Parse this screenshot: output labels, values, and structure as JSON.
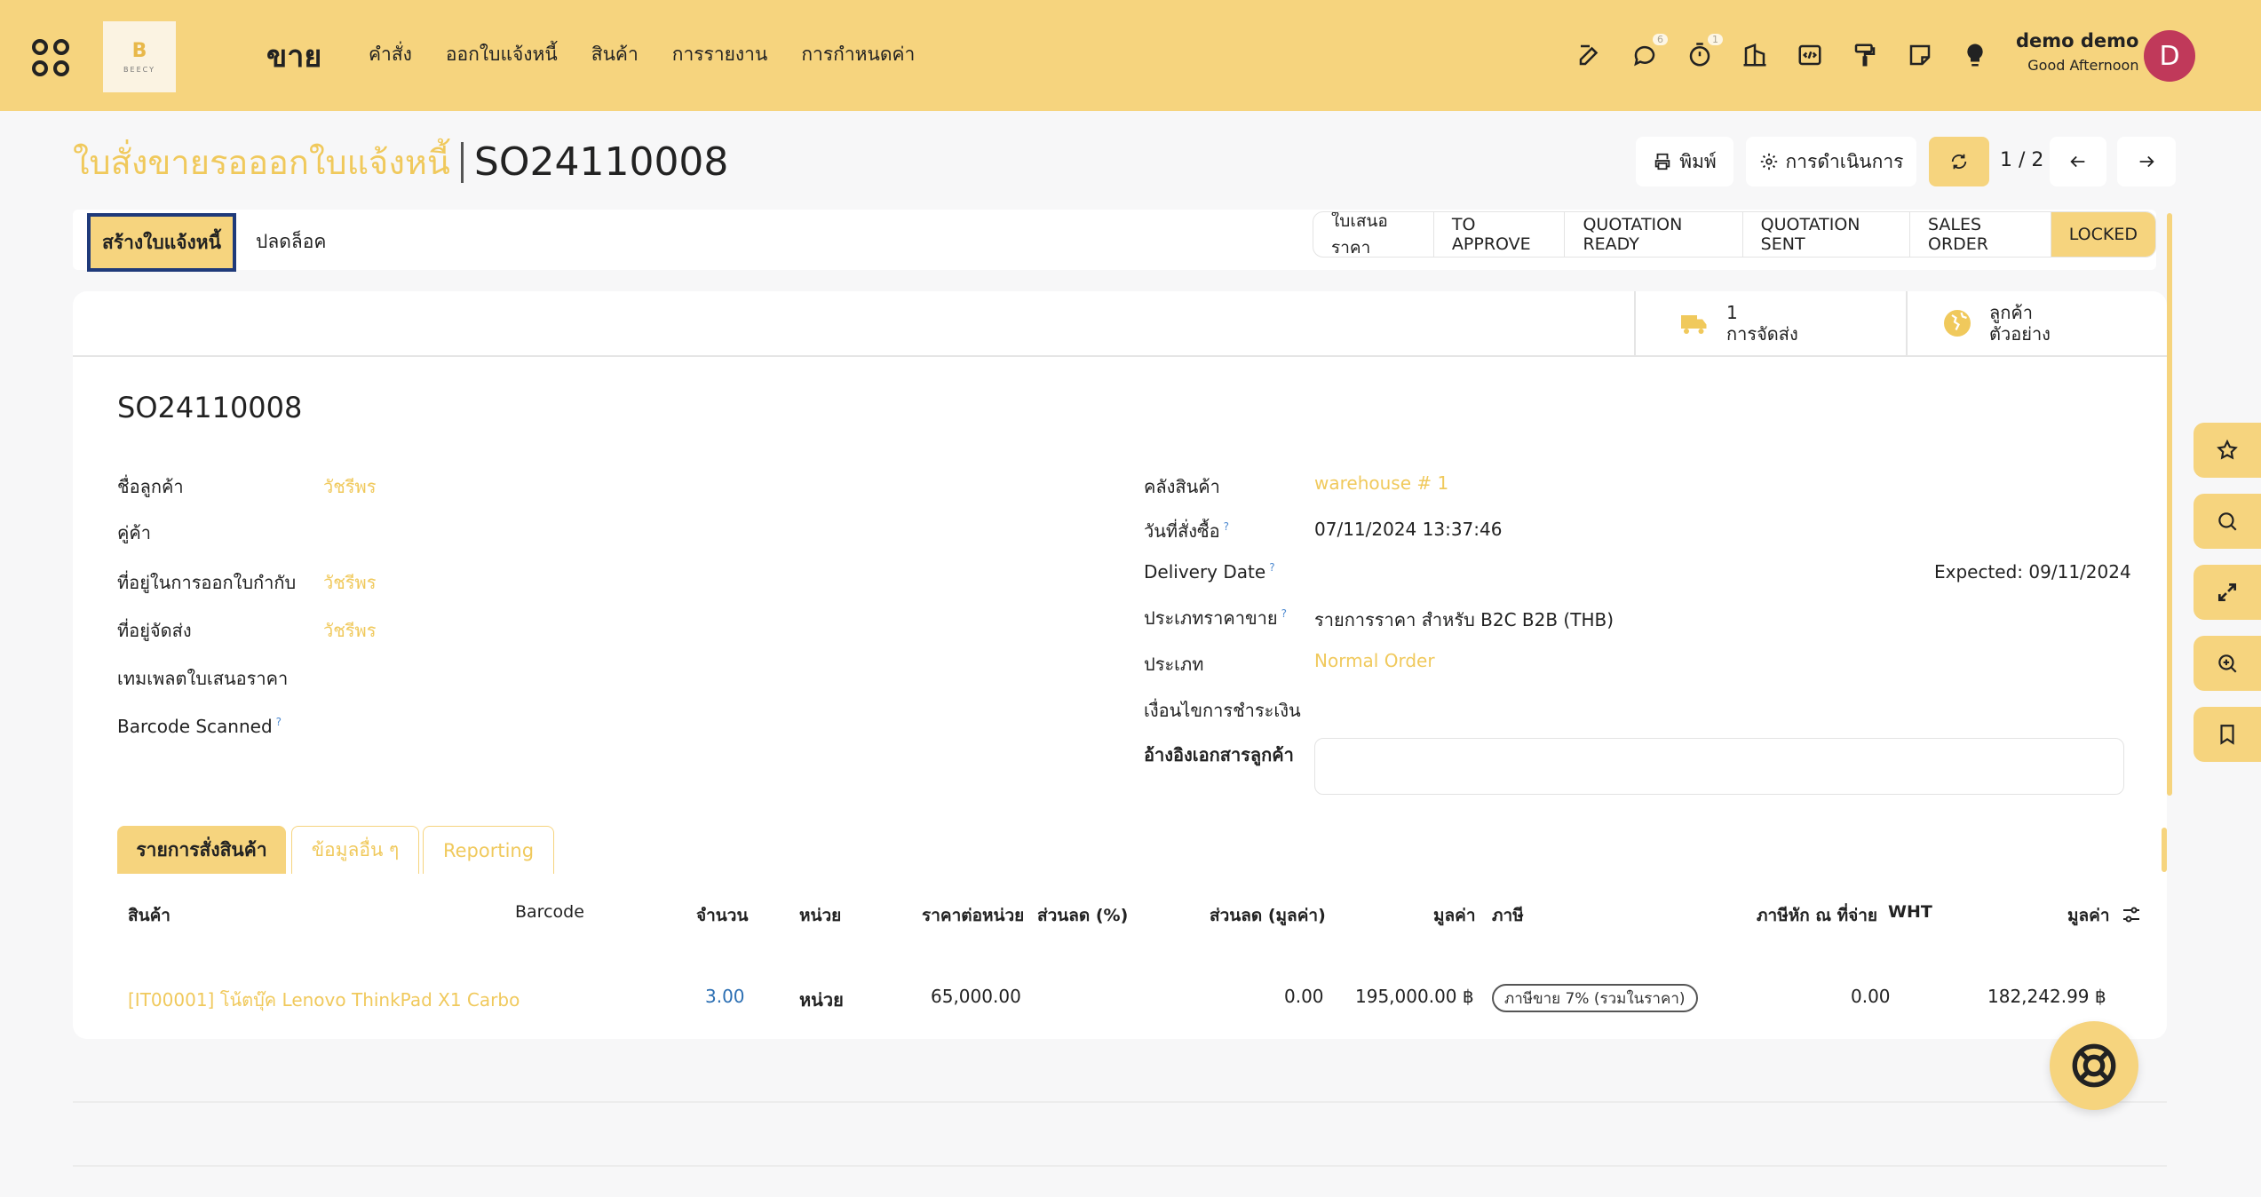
{
  "navbar": {
    "logo_text": "BEECY",
    "logo_glyph": "B",
    "app_title": "ขาย",
    "menu": [
      "คำสั่ง",
      "ออกใบแจ้งหนี้",
      "สินค้า",
      "การรายงาน",
      "การกำหนดค่า"
    ],
    "tray": [
      {
        "icon": "edit-icon",
        "badge": ""
      },
      {
        "icon": "chat-icon",
        "badge": "6"
      },
      {
        "icon": "timer-icon",
        "badge": "1"
      },
      {
        "icon": "building-icon",
        "badge": ""
      },
      {
        "icon": "code-icon",
        "badge": ""
      },
      {
        "icon": "paint-roller-icon",
        "badge": ""
      },
      {
        "icon": "sticky-note-icon",
        "badge": ""
      },
      {
        "icon": "lightbulb-icon",
        "badge": ""
      }
    ],
    "user_name": "demo demo",
    "user_greeting": "Good Afternoon",
    "avatar_letter": "D"
  },
  "control": {
    "breadcrumb_parent": "ใบสั่งขายรอออกใบแจ้งหนี้",
    "breadcrumb_current": "SO24110008",
    "print_label": "พิมพ์",
    "actions_label": "การดำเนินการ",
    "pager": "1 / 2"
  },
  "status": {
    "create_invoice_label": "สร้างใบแจ้งหนี้",
    "unlock_label": "ปลดล็อค",
    "stages": [
      "ใบเสนอราคา",
      "TO APPROVE",
      "QUOTATION READY",
      "QUOTATION SENT",
      "SALES ORDER",
      "LOCKED"
    ],
    "active_stage": "LOCKED"
  },
  "smart_buttons": {
    "delivery_count": "1",
    "delivery_label": "การจัดส่ง",
    "customer_line1": "ลูกค้า",
    "customer_line2": "ตัวอย่าง"
  },
  "form": {
    "name": "SO24110008",
    "left": {
      "customer_label": "ชื่อลูกค้า",
      "customer_value": "วัชรีพร",
      "partner_label": "คู่ค้า",
      "invoice_address_label": "ที่อยู่ในการออกใบกำกับ",
      "invoice_address_value": "วัชรีพร",
      "delivery_address_label": "ที่อยู่จัดส่ง",
      "delivery_address_value": "วัชรีพร",
      "quote_template_label": "เทมเพลตใบเสนอราคา",
      "barcode_label": "Barcode Scanned"
    },
    "right": {
      "warehouse_label": "คลังสินค้า",
      "warehouse_value": "warehouse # 1",
      "order_date_label": "วันที่สั่งซื้อ",
      "order_date_value": "07/11/2024 13:37:46",
      "delivery_date_label": "Delivery Date",
      "delivery_date_value": "Expected: 09/11/2024",
      "pricelist_label": "ประเภทราคาขาย",
      "pricelist_value": "รายการราคา สำหรับ B2C B2B (THB)",
      "type_label": "ประเภท",
      "type_value": "Normal Order",
      "payment_terms_label": "เงื่อนไขการชำระเงิน",
      "customer_ref_label": "อ้างอิงเอกสารลูกค้า"
    },
    "help_mark": "?"
  },
  "tabs": [
    "รายการสั่งสินค้า",
    "ข้อมูลอื่น ๆ",
    "Reporting"
  ],
  "table": {
    "headers": {
      "product": "สินค้า",
      "barcode": "Barcode",
      "qty": "จำนวน",
      "uom": "หน่วย",
      "price": "ราคาต่อหน่วย",
      "disc_pct": "ส่วนลด (%)",
      "disc_amt": "ส่วนลด (มูลค่า)",
      "amount": "มูลค่า",
      "tax": "ภาษี",
      "wht_amt": "ภาษีหัก ณ ที่จ่าย",
      "wht": "WHT",
      "total": "มูลค่า"
    },
    "row": {
      "product": "[IT00001] โน้ตบุ๊ค Lenovo ThinkPad X1 Carbo",
      "qty": "3.00",
      "uom": "หน่วย",
      "price": "65,000.00",
      "disc_amt": "0.00",
      "amount": "195,000.00 ฿",
      "tax": "ภาษีขาย 7% (รวมในราคา)",
      "wht_amt": "0.00",
      "total": "182,242.99 ฿"
    }
  },
  "side_tools": [
    "star-icon",
    "search-icon",
    "expand-icon",
    "zoom-in-icon",
    "bookmark-icon"
  ],
  "colors": {
    "brand": "#f6d47e",
    "link": "#f0c95c",
    "avatar": "#c0395a",
    "focus": "#1f3a7a"
  }
}
